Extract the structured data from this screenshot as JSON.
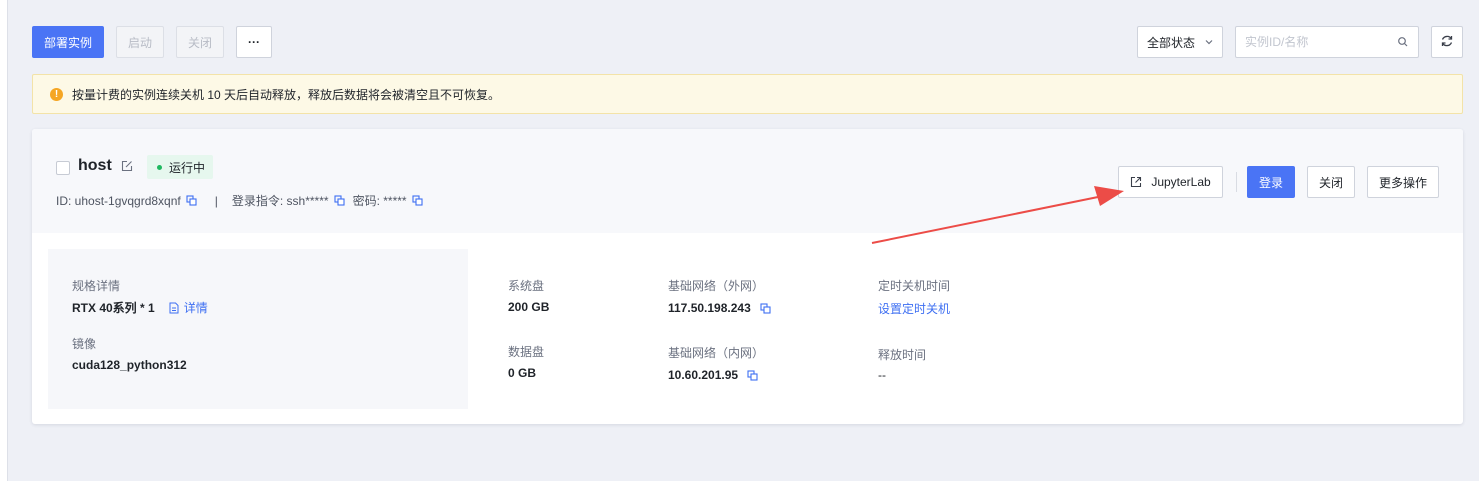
{
  "toolbar": {
    "deploy_label": "部署实例",
    "start_label": "启动",
    "shutdown_label": "关闭",
    "more_label": "···",
    "status_filter": "全部状态",
    "search_placeholder": "实例ID/名称"
  },
  "notice": {
    "text": "按量计费的实例连续关机 10 天后自动释放，释放后数据将会被清空且不可恢复。"
  },
  "instance": {
    "name": "host",
    "status": "运行中",
    "id_label": "ID: uhost-1gvqgrd8xqnf",
    "separator": "|",
    "login_cmd_label": "登录指令: ssh*****",
    "password_label": "密码: *****",
    "actions": {
      "jupyter": "JupyterLab",
      "login": "登录",
      "close": "关闭",
      "more": "更多操作"
    },
    "spec": {
      "spec_label": "规格详情",
      "spec_value": "RTX 40系列 * 1",
      "detail_link": "详情",
      "image_label": "镜像",
      "image_value": "cuda128_python312"
    },
    "disk": {
      "system_label": "系统盘",
      "system_value": "200 GB",
      "data_label": "数据盘",
      "data_value": "0 GB"
    },
    "network": {
      "public_label": "基础网络（外网）",
      "public_ip": "117.50.198.243",
      "private_label": "基础网络（内网）",
      "private_ip": "10.60.201.95"
    },
    "schedule": {
      "shutdown_label": "定时关机时间",
      "shutdown_link": "设置定时关机",
      "release_label": "释放时间",
      "release_value": "--"
    }
  },
  "colors": {
    "primary": "#4a74f5",
    "link": "#3e6ff2",
    "running": "#1fb860",
    "warning": "#f5a623",
    "arrow": "#ec4c47"
  },
  "icons": [
    "chevron-down-icon",
    "search-icon",
    "refresh-icon",
    "warning-icon",
    "edit-icon",
    "copy-icon",
    "external-link-icon",
    "document-icon",
    "annotation-arrow"
  ]
}
